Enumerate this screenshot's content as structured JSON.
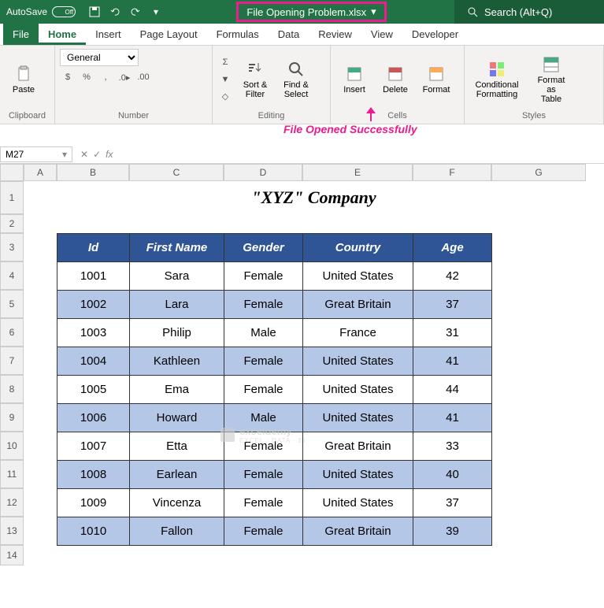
{
  "titlebar": {
    "autosave_label": "AutoSave",
    "autosave_state": "Off",
    "filename": "File Opening Problem.xlsx",
    "search_placeholder": "Search (Alt+Q)"
  },
  "tabs": [
    "File",
    "Home",
    "Insert",
    "Page Layout",
    "Formulas",
    "Data",
    "Review",
    "View",
    "Developer"
  ],
  "active_tab": "Home",
  "ribbon": {
    "clipboard": {
      "label": "Clipboard",
      "paste": "Paste"
    },
    "number": {
      "label": "Number",
      "format": "General"
    },
    "editing": {
      "label": "Editing",
      "sortfilter": "Sort &\nFilter",
      "findselect": "Find &\nSelect"
    },
    "cells": {
      "label": "Cells",
      "insert": "Insert",
      "delete": "Delete",
      "format": "Format"
    },
    "styles": {
      "label": "Styles",
      "cond": "Conditional\nFormatting",
      "table": "Format as\nTable"
    }
  },
  "annotation": "File Opened Successfully",
  "namebox": "M27",
  "columns": [
    "A",
    "B",
    "C",
    "D",
    "E",
    "F",
    "G"
  ],
  "rows": [
    "1",
    "2",
    "3",
    "4",
    "5",
    "6",
    "7",
    "8",
    "9",
    "10",
    "11",
    "12",
    "13",
    "14"
  ],
  "sheet_title": "\"XYZ\" Company",
  "table": {
    "headers": [
      "Id",
      "First Name",
      "Gender",
      "Country",
      "Age"
    ],
    "rows": [
      [
        "1001",
        "Sara",
        "Female",
        "United States",
        "42"
      ],
      [
        "1002",
        "Lara",
        "Female",
        "Great Britain",
        "37"
      ],
      [
        "1003",
        "Philip",
        "Male",
        "France",
        "31"
      ],
      [
        "1004",
        "Kathleen",
        "Female",
        "United States",
        "41"
      ],
      [
        "1005",
        "Ema",
        "Female",
        "United States",
        "44"
      ],
      [
        "1006",
        "Howard",
        "Male",
        "United States",
        "41"
      ],
      [
        "1007",
        "Etta",
        "Female",
        "Great Britain",
        "33"
      ],
      [
        "1008",
        "Earlean",
        "Female",
        "United States",
        "40"
      ],
      [
        "1009",
        "Vincenza",
        "Female",
        "United States",
        "37"
      ],
      [
        "1010",
        "Fallon",
        "Female",
        "Great Britain",
        "39"
      ]
    ]
  },
  "watermark": {
    "text": "exceldemy",
    "sub": "EXCEL · DATA · BI"
  }
}
